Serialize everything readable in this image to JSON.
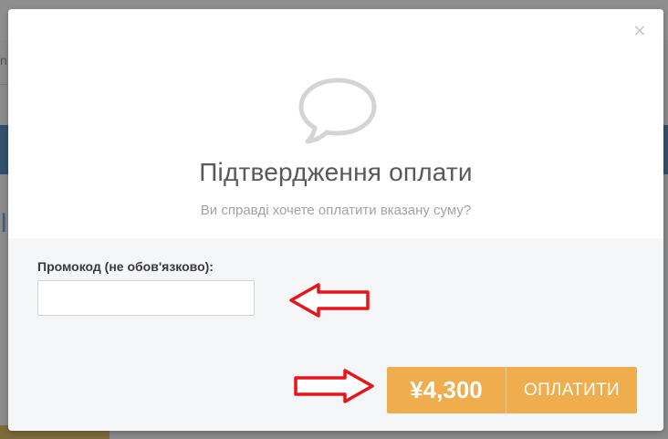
{
  "background": {
    "left_text": "n",
    "left_glyph": "I"
  },
  "modal": {
    "close_symbol": "×",
    "title": "Підтвердження оплати",
    "subtitle": "Ви справді хочете оплатити вказану суму?",
    "promo_label": "Промокод (не обов'язково):",
    "promo_value": "",
    "promo_placeholder": "",
    "pay_amount": "¥4,300",
    "pay_label": "ОПЛАТИТИ"
  },
  "icons": {
    "header_icon": "speech-bubble-icon",
    "close_icon": "close-icon"
  },
  "annotations": {
    "arrow_color": "#e8141a",
    "arrow_fill": "#ffffff"
  },
  "colors": {
    "accent": "#f0ad4e",
    "title": "#595959",
    "subtitle": "#a3a3a3",
    "body_bg": "#f5f6f8",
    "icon": "#d4d4d4"
  }
}
